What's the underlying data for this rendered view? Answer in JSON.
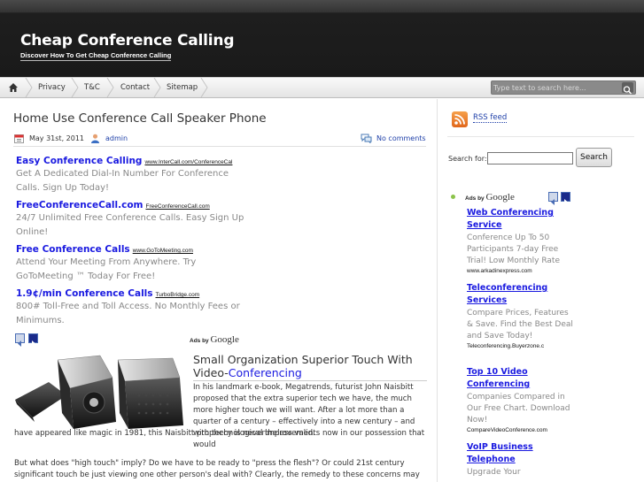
{
  "site": {
    "title": "Cheap Conference Calling",
    "tagline": "Discover How To Get Cheap Conference Calling"
  },
  "nav": {
    "home_icon": "home-icon",
    "items": [
      "Privacy",
      "T&C",
      "Contact",
      "Sitemap"
    ],
    "search_placeholder": "Type text to search here...",
    "search_icon": "search-icon"
  },
  "post": {
    "title": "Home Use Conference Call Speaker Phone",
    "date": "May 31st, 2011",
    "author": "admin",
    "comments": "No comments"
  },
  "ads": [
    {
      "headline": "Easy Conference Calling",
      "url": "www.InterCall.com/ConferenceCal",
      "desc": "Get A Dedicated Dial-In Number For Conference Calls. Sign Up Today!"
    },
    {
      "headline": "FreeConferenceCall.com",
      "url": "FreeConferenceCall.com",
      "desc": "24/7 Unlimited Free Conference Calls. Easy Sign Up Online!"
    },
    {
      "headline": "Free Conference Calls",
      "url": "www.GoToMeeting.com",
      "desc": "Attend Your Meeting From Anywhere. Try GoToMeeting ™ Today For Free!"
    },
    {
      "headline": "1.9¢/min Conference Calls",
      "url": "TurboBridge.com",
      "desc": "800# Toll-Free and Toll Access. No Monthly Fees or Minimums."
    }
  ],
  "ads_by": {
    "prefix": "Ads by",
    "brand": "Google"
  },
  "article": {
    "heading_prefix": "Small Organization Superior Touch With Video-",
    "heading_highlight": "Conferencing",
    "p1a": "In his landmark e-book, Megatrends, futurist John Naisbitt proposed that the extra superior tech we have, the much more higher touch we will want. After a lot more than a quarter of a century – effectively into a new century – and with technological improvements now in our possession that would",
    "p1b": "have appeared like magic in 1981, this Naisbitt prophecy is nevertheless valid.",
    "p2": "But what does \"high touch\" imply? Do we have to be ready to \"press the flesh\"? Or could 21st century significant touch be just viewing one other person's deal with? Clearly, the remedy to these concerns may be"
  },
  "sidebar": {
    "rss_label": "RSS feed",
    "search_label": "Search for:",
    "search_button": "Search",
    "ads": [
      {
        "headline": "Web Conferencing Service",
        "desc": "Conference Up To 50 Participants 7-day Free Trial! Low Monthly Rate",
        "url": "www.arkadinexpress.com"
      },
      {
        "headline": "Teleconferencing Services",
        "desc": "Compare Prices, Features & Save. Find the Best Deal and Save Today!",
        "url": "Teleconferencing.Buyerzone.c"
      },
      {
        "headline": "Top 10 Video Conferencing",
        "desc": "Companies Compared in Our Free Chart. Download Now!",
        "url": "CompareVideoConference.com"
      },
      {
        "headline": "VoIP Business Telephone",
        "desc": "Upgrade Your",
        "url": ""
      }
    ]
  },
  "colors": {
    "link_blue": "#1a1ae0",
    "header_bg": "#1a1a1a",
    "rss_orange": "#e0661a"
  }
}
